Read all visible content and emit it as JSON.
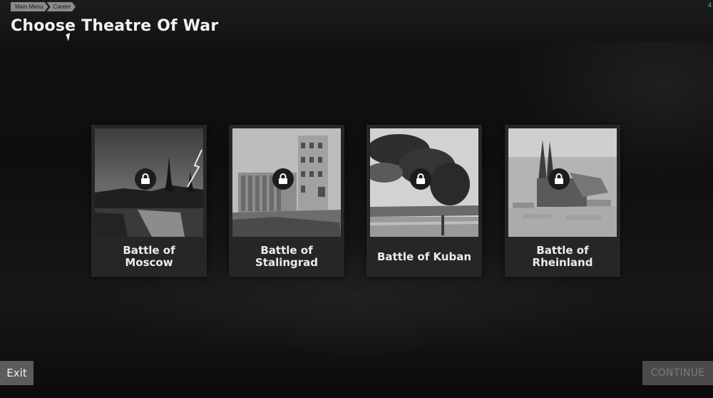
{
  "breadcrumb": [
    "Main Menu",
    "Career"
  ],
  "page_title": "Choose Theatre Of War",
  "fps_counter": "4",
  "cards": [
    {
      "label": "Battle of\nMoscow",
      "locked": true,
      "icon": "lock-icon"
    },
    {
      "label": "Battle of\nStalingrad",
      "locked": true,
      "icon": "lock-icon"
    },
    {
      "label": "Battle of Kuban",
      "locked": true,
      "icon": "lock-icon"
    },
    {
      "label": "Battle of\nRheinland",
      "locked": true,
      "icon": "lock-icon"
    }
  ],
  "footer": {
    "exit_label": "Exit",
    "continue_label": "CONTINUE"
  },
  "colors": {
    "card_bg": "#262626",
    "lock_badge": "#1d1d1d",
    "exit_bg": "#5c5c5c",
    "continue_bg_disabled": "#4b4b4b",
    "fps_text": "#3ccf3c"
  }
}
